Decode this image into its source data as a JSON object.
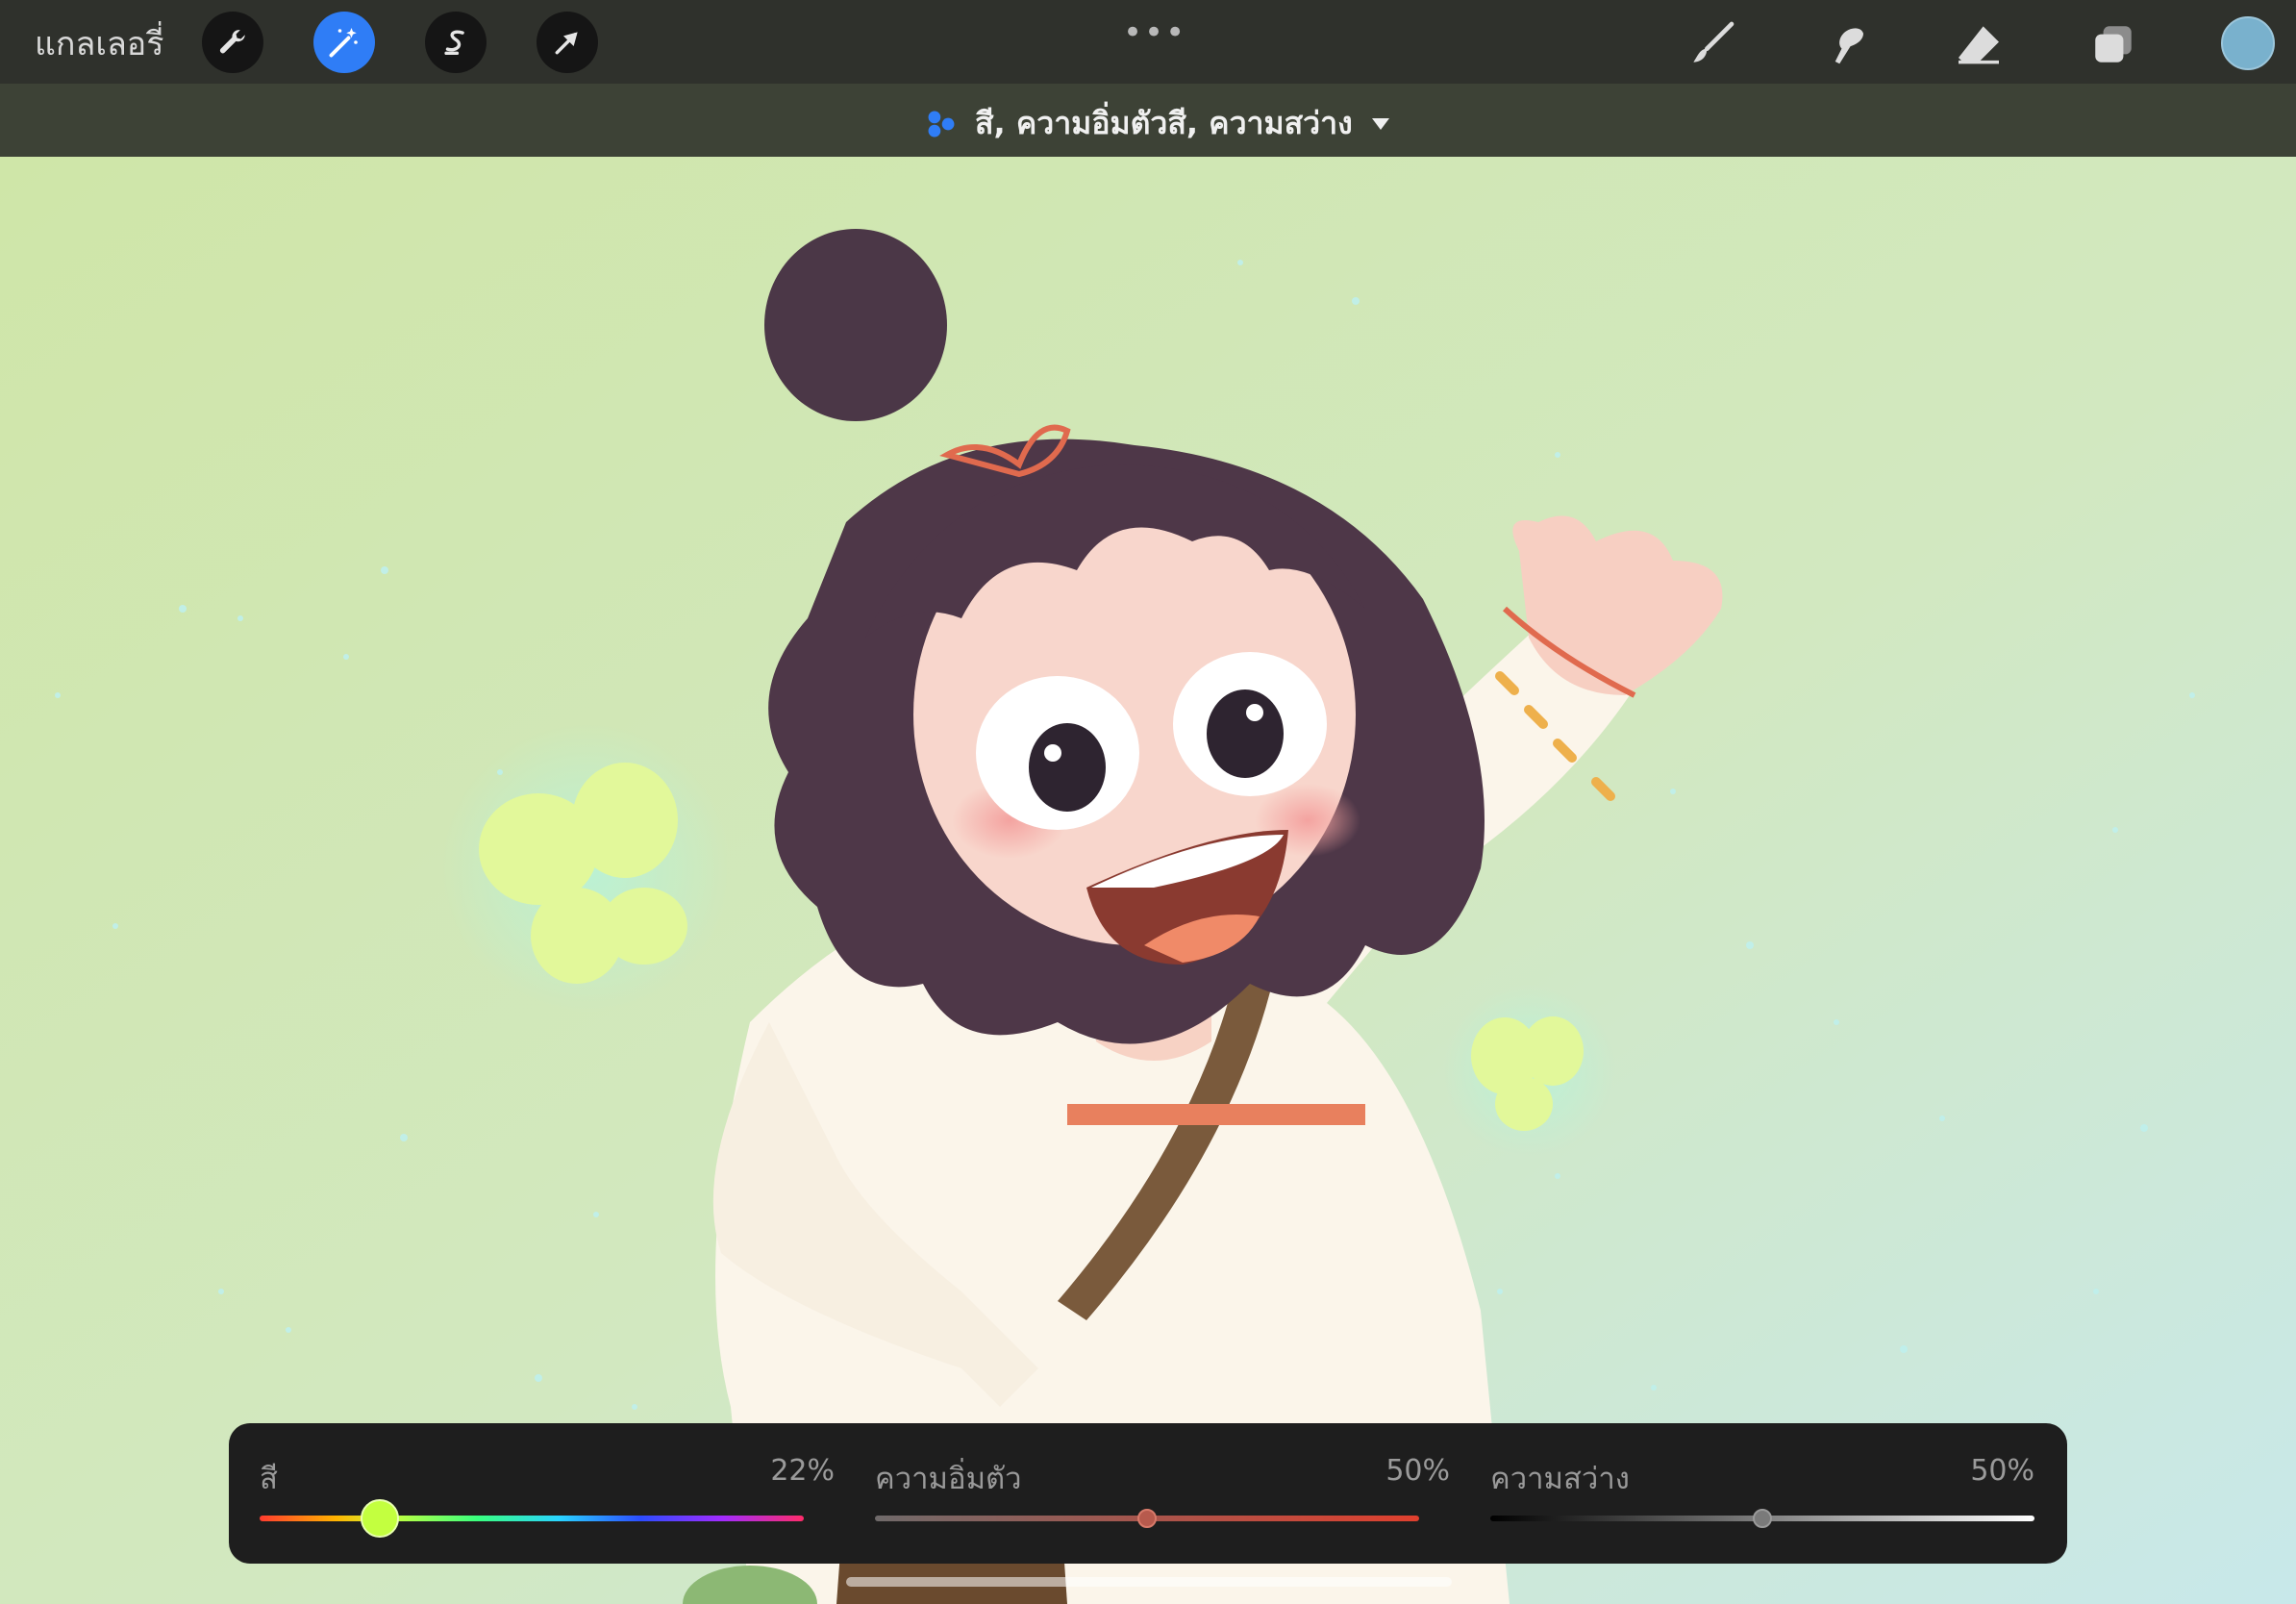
{
  "topbar": {
    "gallery_label": "แกลเลอรี่",
    "left_tools": [
      "wrench-icon",
      "magic-wand-icon",
      "selection-icon",
      "transform-arrow-icon"
    ],
    "active_tool": "magic-wand-icon",
    "right_tools": [
      "brush-icon",
      "smudge-icon",
      "eraser-icon",
      "layers-icon"
    ],
    "current_color": "#79b1cd"
  },
  "adjustment": {
    "mode_label": "สี, ความอิ่มตัวสี, ความสว่าง"
  },
  "sliders": {
    "hue": {
      "label": "สี",
      "value_text": "22%",
      "value": 0.22
    },
    "saturation": {
      "label": "ความอิ่มตัว",
      "value_text": "50%",
      "value": 0.5
    },
    "brightness": {
      "label": "ความสว่าง",
      "value_text": "50%",
      "value": 0.5
    }
  },
  "colors": {
    "accent": "#2f7df6",
    "hue_knob": "#c3ff3f"
  }
}
